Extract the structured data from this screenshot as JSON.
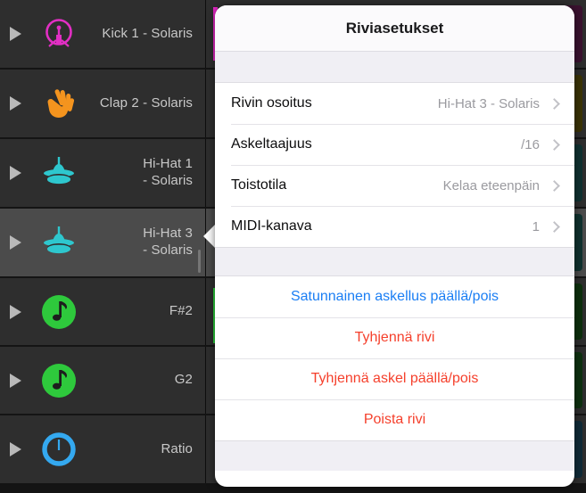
{
  "tracks": [
    {
      "label": "Kick 1 - Solaris",
      "icon": "kick-drum-icon",
      "icon_color": "#e22fc4",
      "selected": false,
      "step_color": "#3b1230"
    },
    {
      "label": "Clap 2 - Solaris",
      "icon": "clap-hand-icon",
      "icon_color": "#f4941e",
      "selected": false,
      "step_color": "#3b3306"
    },
    {
      "label": "Hi-Hat 1\n- Solaris",
      "icon": "hi-hat-icon",
      "icon_color": "#2ec7ce",
      "selected": false,
      "step_color": "#103231"
    },
    {
      "label": "Hi-Hat 3\n- Solaris",
      "icon": "hi-hat-icon",
      "icon_color": "#2ec7ce",
      "selected": true,
      "step_color": "#10322f"
    },
    {
      "label": "F#2",
      "icon": "note-icon",
      "icon_color": "#2ec93c",
      "selected": false,
      "step_color": "#0d300d"
    },
    {
      "label": "G2",
      "icon": "note-icon",
      "icon_color": "#2ec93c",
      "selected": false,
      "step_color": "#0e3110"
    },
    {
      "label": "Ratio",
      "icon": "clock-ratio-icon",
      "icon_color": "#34a9f0",
      "selected": false,
      "step_color": "#102b38"
    }
  ],
  "popup": {
    "title": "Riviasetukset",
    "settings": [
      {
        "label": "Rivin osoitus",
        "value": "Hi-Hat 3 - Solaris",
        "chevron": "chevron-right-icon"
      },
      {
        "label": "Askeltaajuus",
        "value": "/16",
        "chevron": "chevron-right-icon"
      },
      {
        "label": "Toistotila",
        "value": "Kelaa eteenpäin",
        "chevron": "chevron-right-icon"
      },
      {
        "label": "MIDI-kanava",
        "value": "1",
        "chevron": "chevron-right-icon"
      }
    ],
    "actions": [
      {
        "label": "Satunnainen askellus päällä/pois",
        "style": "blue"
      },
      {
        "label": "Tyhjennä rivi",
        "style": "red"
      },
      {
        "label": "Tyhjennä askel päällä/pois",
        "style": "red"
      },
      {
        "label": "Poista rivi",
        "style": "red"
      }
    ]
  },
  "colors": {
    "blue_action": "#1a7ef4",
    "red_action": "#f5402c",
    "accent_magenta": "#e828c8",
    "accent_green": "#2fd13e",
    "selected_row": "#4b4b4b",
    "row_background": "#2e2e2e"
  }
}
